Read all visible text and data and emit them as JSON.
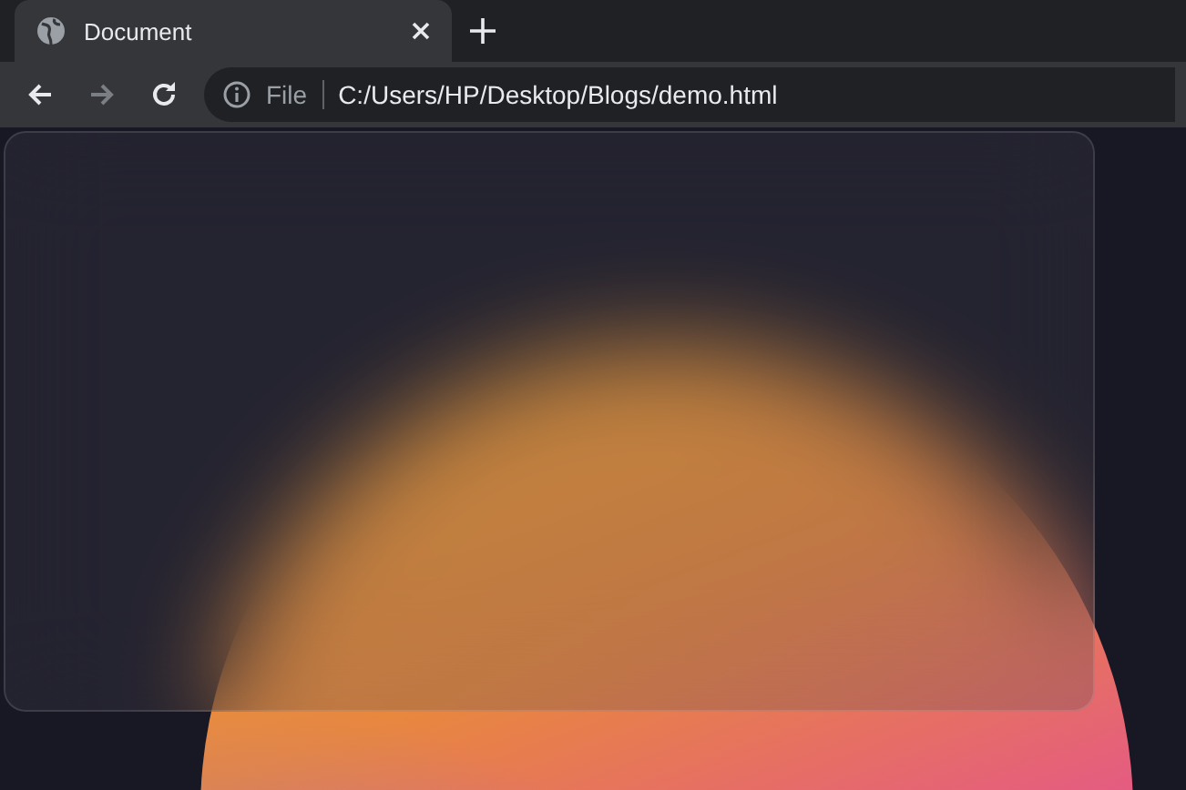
{
  "tabs": [
    {
      "title": "Document",
      "selected": true
    }
  ],
  "nav": [
    {
      "kind": "back",
      "disabled": false
    },
    {
      "kind": "forward",
      "disabled": true
    },
    {
      "kind": "reload",
      "disabled": false
    }
  ],
  "address_bar": {
    "scheme": "File",
    "url": "C:/Users/HP/Desktop/Blogs/demo.html"
  }
}
